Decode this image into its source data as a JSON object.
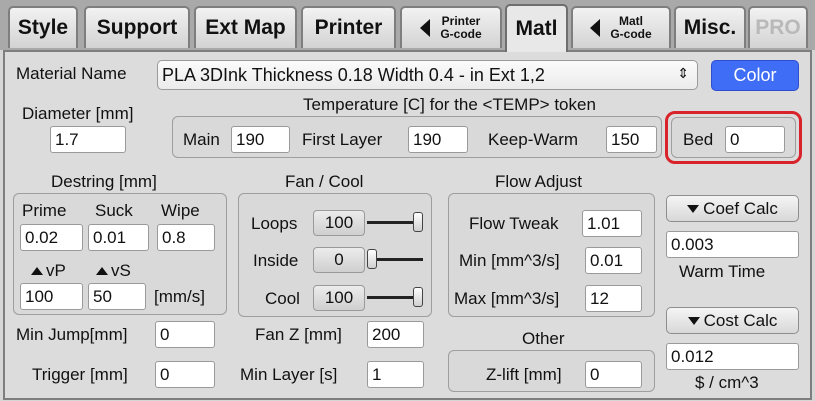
{
  "tabs": {
    "style": "Style",
    "support": "Support",
    "ext_map": "Ext Map",
    "printer": "Printer",
    "printer_gcode_line1": "Printer",
    "printer_gcode_line2": "G-code",
    "matl": "Matl",
    "matl_gcode_line1": "Matl",
    "matl_gcode_line2": "G-code",
    "misc": "Misc.",
    "pro": "PRO"
  },
  "material": {
    "label": "Material Name",
    "value": "PLA 3DInk Thickness 0.18 Width 0.4 - in Ext 1,2",
    "color_button": "Color",
    "color_button_bg": "#3f6df5"
  },
  "diameter": {
    "label": "Diameter [mm]",
    "value": "1.7"
  },
  "temperature": {
    "header": "Temperature [C] for the <TEMP> token",
    "main_label": "Main",
    "main_value": "190",
    "first_layer_label": "First Layer",
    "first_layer_value": "190",
    "keep_warm_label": "Keep-Warm",
    "keep_warm_value": "150",
    "bed_label": "Bed",
    "bed_value": "0"
  },
  "destring": {
    "header": "Destring [mm]",
    "prime_label": "Prime",
    "prime_value": "0.02",
    "suck_label": "Suck",
    "suck_value": "0.01",
    "wipe_label": "Wipe",
    "wipe_value": "0.8",
    "vp_label": "vP",
    "vp_value": "100",
    "vs_label": "vS",
    "vs_value": "50",
    "speed_unit": "[mm/s]",
    "min_jump_label": "Min Jump[mm]",
    "min_jump_value": "0",
    "trigger_label": "Trigger [mm]",
    "trigger_value": "0"
  },
  "fan": {
    "header": "Fan / Cool",
    "loops_label": "Loops",
    "loops_value": "100",
    "loops_level": 1.0,
    "inside_label": "Inside",
    "inside_value": "0",
    "inside_level": 0.0,
    "cool_label": "Cool",
    "cool_value": "100",
    "cool_level": 1.0,
    "fan_z_label": "Fan Z [mm]",
    "fan_z_value": "200",
    "min_layer_label": "Min Layer [s]",
    "min_layer_value": "1"
  },
  "flow": {
    "header": "Flow Adjust",
    "tweak_label": "Flow Tweak",
    "tweak_value": "1.01",
    "min_label": "Min [mm^3/s]",
    "min_value": "0.01",
    "max_label": "Max [mm^3/s]",
    "max_value": "12"
  },
  "other": {
    "header": "Other",
    "zlift_label": "Z-lift [mm]",
    "zlift_value": "0"
  },
  "coef": {
    "button": "Coef Calc",
    "value": "0.003",
    "caption": "Warm Time"
  },
  "cost": {
    "button": "Cost Calc",
    "value": "0.012",
    "caption": "$ / cm^3"
  },
  "colors": {
    "highlight": "#d8232a",
    "pro_text": "#b9b9b9"
  }
}
